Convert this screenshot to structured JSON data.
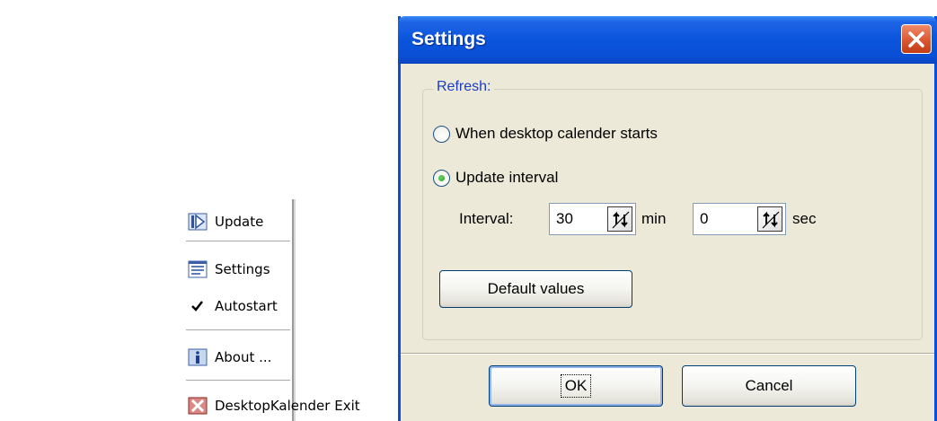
{
  "context_menu": {
    "items": [
      {
        "label": "Update",
        "icon": "update-icon"
      },
      {
        "label": "Settings",
        "icon": "settings-list-icon"
      },
      {
        "label": "Autostart",
        "icon": "checkmark-icon",
        "checked": true
      },
      {
        "label": "About ...",
        "icon": "info-icon"
      },
      {
        "label": "DesktopKalender Exit",
        "icon": "exit-icon"
      }
    ]
  },
  "dialog": {
    "title": "Settings",
    "group_legend": "Refresh:",
    "radio_on_start": {
      "label": "When desktop calender starts",
      "checked": false
    },
    "radio_interval": {
      "label": "Update interval",
      "checked": true
    },
    "interval_label": "Interval:",
    "minutes_value": "30",
    "minutes_unit": "min",
    "seconds_value": "0",
    "seconds_unit": "sec",
    "default_values_label": "Default values",
    "ok_label": "OK",
    "cancel_label": "Cancel"
  },
  "colors": {
    "titlebar_blue": "#0a55dd",
    "dialog_background": "#ece9d8",
    "legend_text": "#1c3cc4",
    "close_red": "#d8542c"
  }
}
